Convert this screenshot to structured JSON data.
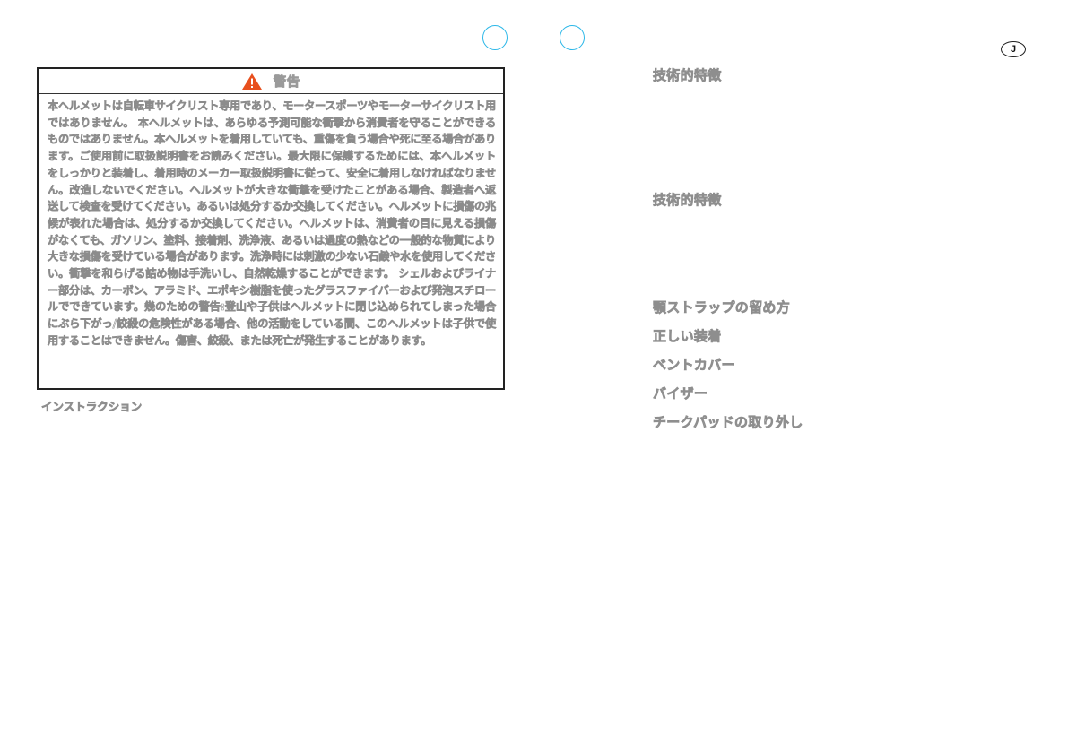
{
  "page": {
    "language_badge": "J"
  },
  "warning": {
    "icon": "warning-triangle-icon",
    "icon_color": "#e8501e",
    "title": "警告",
    "body": "本ヘルメットは自転車サイクリスト専用であり、モータースポーツやモーターサイクリスト用ではありません。 本ヘルメットは、あらゆる予測可能な衝撃から消費者を守ることができるものではありません。本ヘルメットを着用していても、重傷を負う場合や死に至る場合があります。ご使用前に取扱説明書をお読みください。最大限に保護するためには、本ヘルメットをしっかりと装着し、着用時のメーカー取扱説明書に従って、安全に着用しなければなりません。改造しないでください。ヘルメットが大きな衝撃を受けたことがある場合、製造者へ返送して検査を受けてください。あるいは処分するか交換してください。ヘルメットに損傷の兆候が表れた場合は、処分するか交換してください。ヘルメットは、消費者の目に見える損傷がなくても、ガソリン、塗料、接着剤、洗浄液、あるいは過度の熱などの一般的な物質により大きな損傷を受けている場合があります。洗浄時には刺激の少ない石鹸や水を使用してください。衝撃を和らげる詰め物は手洗いし、自然乾燥することができます。 シェルおよびライナー部分は、カーボン、アラミド、エポキシ樹脂を使ったグラスファイバーおよび発泡スチロールでできています。幾のための警告:登山や子供はヘルメットに閉じ込められてしまった場合にぶら下がっ/絞殺の危険性がある場合、他の活動をしている間、このヘルメットは子供で使用することはできません。傷害、絞殺、または死亡が発生することがあります。"
  },
  "instructions_label": "インストラクション",
  "toc": {
    "items": [
      "技術的特徴",
      "技術的特徴",
      "顎ストラップの留め方",
      "正しい装着",
      "ベントカバー",
      "バイザー",
      "チークパッドの取り外し"
    ]
  }
}
